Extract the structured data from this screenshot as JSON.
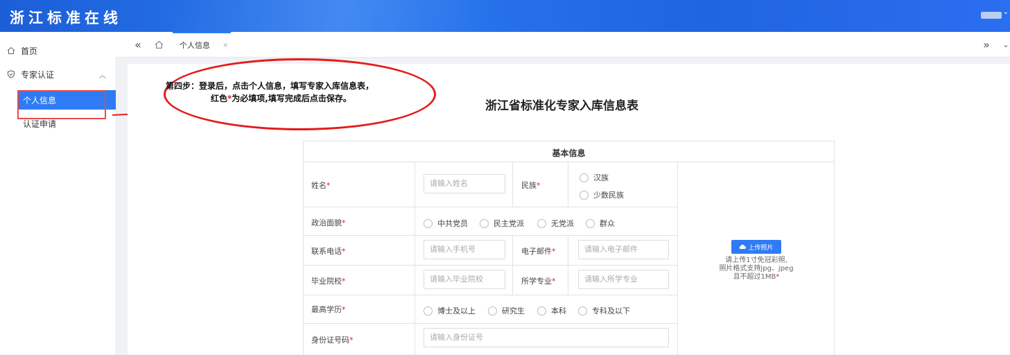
{
  "header": {
    "logo": "浙江标准在线"
  },
  "sidebar": {
    "home": "首页",
    "expert": "专家认证",
    "personal_info": "个人信息",
    "apply": "认证申请"
  },
  "tabs": {
    "active": "个人信息",
    "close": "×"
  },
  "annotation": {
    "line1": "第四步：登录后，点击个人信息，填写专家入库信息表，",
    "line2_pre": "红色",
    "line2_star": "*",
    "line2_post": "为必填项,填写完成后点击保存。"
  },
  "form": {
    "title": "浙江省标准化专家入库信息表",
    "section": "基本信息",
    "name_label": "姓名",
    "name_placeholder": "请输入姓名",
    "ethnic_label": "民族",
    "ethnic_options": [
      "汉族",
      "少数民族"
    ],
    "political_label": "政治面貌",
    "political_options": [
      "中共党员",
      "民主党派",
      "无党派",
      "群众"
    ],
    "phone_label": "联系电话",
    "phone_placeholder": "请输入手机号",
    "email_label": "电子邮件",
    "email_placeholder": "请输入电子邮件",
    "school_label": "毕业院校",
    "school_placeholder": "请输入毕业院校",
    "major_label": "所学专业",
    "major_placeholder": "请输入所学专业",
    "edu_label": "最高学历",
    "edu_options": [
      "博士及以上",
      "研究生",
      "本科",
      "专科及以下"
    ],
    "id_label": "身份证号码",
    "id_placeholder": "请输入身份证号",
    "required_mark": "*",
    "upload_btn": "上传照片",
    "upload_note": [
      "请上传1寸免冠彩照,",
      "照片格式支持jpg、jpeg",
      "且不超过1MB"
    ]
  }
}
